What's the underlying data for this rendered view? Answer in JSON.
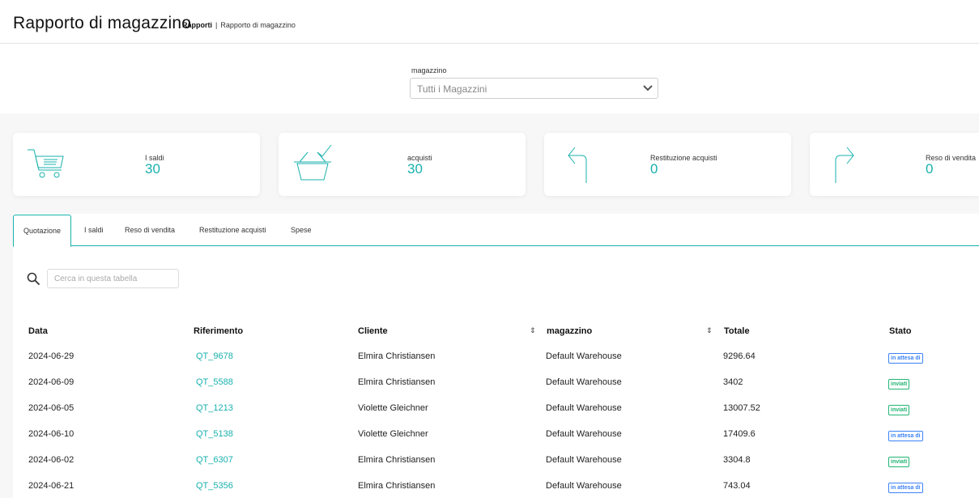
{
  "header": {
    "title": "Rapporto di magazzino",
    "breadcrumb": [
      "Rapporti",
      "Rapporto di magazzino"
    ]
  },
  "filter": {
    "label": "magazzino",
    "selected": "Tutti i Magazzini"
  },
  "cards": [
    {
      "label": "I saldi",
      "value": "30",
      "icon": "shopping-cart-icon"
    },
    {
      "label": "acquisti",
      "value": "30",
      "icon": "basket-check-icon"
    },
    {
      "label": "Restituzione acquisti",
      "value": "0",
      "icon": "return-arrow-icon"
    },
    {
      "label": "Reso di vendita",
      "value": "0",
      "icon": "forward-arrow-icon"
    }
  ],
  "tabs": [
    "Quotazione",
    "I saldi",
    "Reso di vendita",
    "Restituzione acquisti",
    "Spese"
  ],
  "active_tab": "Quotazione",
  "search": {
    "placeholder": "Cerca in questa tabella"
  },
  "table": {
    "columns": [
      "Data",
      "Riferimento",
      "Cliente",
      "magazzino",
      "Totale",
      "Stato"
    ],
    "rows": [
      {
        "date": "2024-06-29",
        "ref": "QT_9678",
        "client": "Elmira Christiansen",
        "warehouse": "Default Warehouse",
        "total": "9296.64",
        "status": "in attesa di"
      },
      {
        "date": "2024-06-09",
        "ref": "QT_5588",
        "client": "Elmira Christiansen",
        "warehouse": "Default Warehouse",
        "total": "3402",
        "status": "inviati"
      },
      {
        "date": "2024-06-05",
        "ref": "QT_1213",
        "client": "Violette Gleichner",
        "warehouse": "Default Warehouse",
        "total": "13007.52",
        "status": "inviati"
      },
      {
        "date": "2024-06-10",
        "ref": "QT_5138",
        "client": "Violette Gleichner",
        "warehouse": "Default Warehouse",
        "total": "17409.6",
        "status": "in attesa di"
      },
      {
        "date": "2024-06-02",
        "ref": "QT_6307",
        "client": "Elmira Christiansen",
        "warehouse": "Default Warehouse",
        "total": "3304.8",
        "status": "inviati"
      },
      {
        "date": "2024-06-21",
        "ref": "QT_5356",
        "client": "Elmira Christiansen",
        "warehouse": "Default Warehouse",
        "total": "743.04",
        "status": "in attesa di"
      }
    ]
  },
  "colors": {
    "accent": "#19b1ad",
    "pending": "#3b82f6",
    "sent": "#22b573"
  }
}
